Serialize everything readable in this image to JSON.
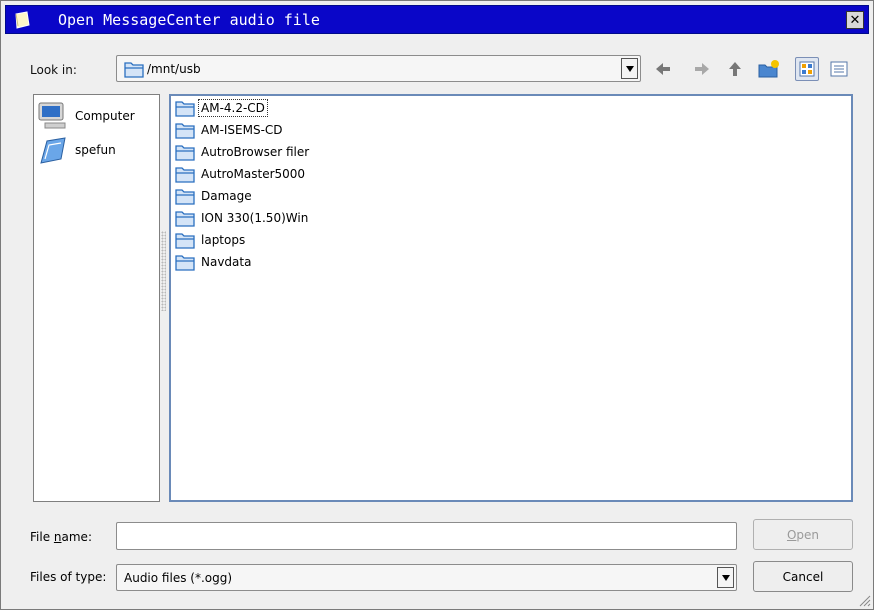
{
  "window": {
    "title": "Open MessageCenter audio file",
    "title_icon": "notepad-icon",
    "close_icon": "close-icon"
  },
  "look_in": {
    "label": "Look in:",
    "path": "/mnt/usb"
  },
  "toolbar": {
    "icons": [
      "back-arrow-icon",
      "forward-arrow-icon",
      "up-arrow-icon",
      "new-folder-icon",
      "icon-view-icon",
      "detail-view-icon"
    ]
  },
  "places": [
    {
      "label": "Computer",
      "icon": "computer-icon"
    },
    {
      "label": "spefun",
      "icon": "home-folder-icon"
    }
  ],
  "files": [
    {
      "name": "AM-4.2-CD"
    },
    {
      "name": "AM-ISEMS-CD"
    },
    {
      "name": "AutroBrowser filer"
    },
    {
      "name": "AutroMaster5000"
    },
    {
      "name": "Damage"
    },
    {
      "name": "ION 330(1.50)Win"
    },
    {
      "name": "laptops"
    },
    {
      "name": "Navdata"
    }
  ],
  "file_name": {
    "label_pre": "File ",
    "label_ul": "n",
    "label_post": "ame:",
    "value": ""
  },
  "file_type": {
    "label": "Files of type:",
    "value": "Audio files (*.ogg)"
  },
  "buttons": {
    "open_ul": "O",
    "open_rest": "pen",
    "cancel": "Cancel"
  },
  "colors": {
    "titlebar": "#0a06c8",
    "list_border": "#6a8ab8",
    "folder_blue": "#2a6fc0"
  }
}
